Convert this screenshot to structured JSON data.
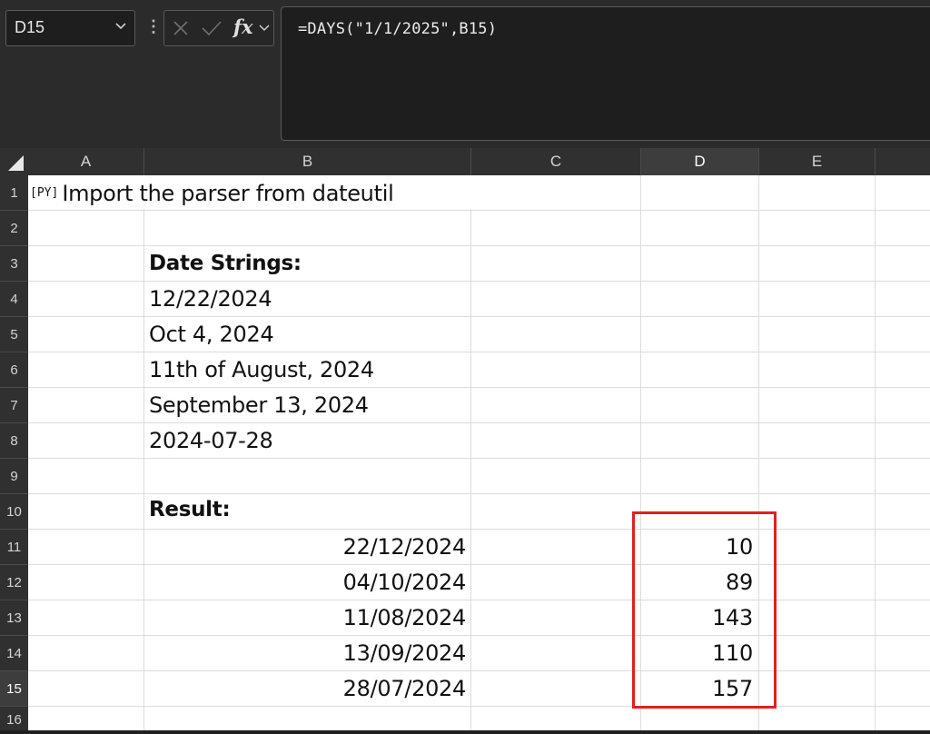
{
  "formula_bar": {
    "name_box": "D15",
    "formula": "=DAYS(\"1/1/2025\",B15)",
    "fx_label": "fx"
  },
  "columns": [
    "A",
    "B",
    "C",
    "D",
    "E"
  ],
  "selected_column": "D",
  "rows": [
    "1",
    "2",
    "3",
    "4",
    "5",
    "6",
    "7",
    "8",
    "9",
    "10",
    "11",
    "12",
    "13",
    "14",
    "15",
    "16"
  ],
  "selected_row": "15",
  "sheet": {
    "py_badge": "[PY]",
    "a1": "Import the parser from dateutil",
    "b3": "Date Strings:",
    "b4": "12/22/2024",
    "b5": "Oct 4, 2024",
    "b6": "11th of August, 2024",
    "b7": "September 13, 2024",
    "b8": "2024-07-28",
    "b10": "Result:",
    "b11": "22/12/2024",
    "b12": "04/10/2024",
    "b13": "11/08/2024",
    "b14": "13/09/2024",
    "b15": "28/07/2024",
    "d11": "10",
    "d12": "89",
    "d13": "143",
    "d14": "110",
    "d15": "157"
  },
  "colors": {
    "highlight_border": "#e02020",
    "ribbon_bg": "#2b2b2b",
    "header_bg": "#303030"
  }
}
